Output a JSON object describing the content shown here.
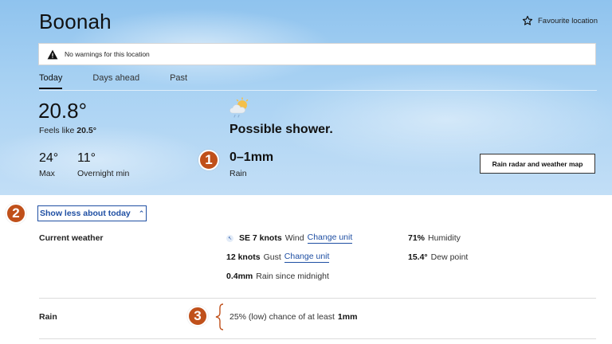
{
  "header": {
    "location": "Boonah",
    "favourite_label": "Favourite location"
  },
  "warning": {
    "text": "No warnings for this location",
    "icon": "warning-triangle-icon"
  },
  "tabs": [
    {
      "label": "Today",
      "active": true
    },
    {
      "label": "Days ahead",
      "active": false
    },
    {
      "label": "Past",
      "active": false
    }
  ],
  "today": {
    "temperature": "20.8°",
    "feels_like_label": "Feels like",
    "feels_like_value": "20.5°",
    "max_value": "24°",
    "max_label": "Max",
    "overnight_value": "11°",
    "overnight_label": "Overnight min",
    "forecast": "Possible shower.",
    "rain_value": "0–1mm",
    "rain_label": "Rain",
    "radar_button": "Rain radar and weather map",
    "weather_icon": "possible-shower-icon"
  },
  "callouts": [
    "1",
    "2",
    "3"
  ],
  "details": {
    "toggle_label": "Show less about today",
    "current_weather_label": "Current weather",
    "wind_value": "SE 7 knots",
    "wind_label": "Wind",
    "gust_value": "12 knots",
    "gust_label": "Gust",
    "change_unit": "Change unit",
    "rain_midnight_value": "0.4mm",
    "rain_midnight_label": "Rain since midnight",
    "humidity_value": "71%",
    "humidity_label": "Humidity",
    "dewpoint_value": "15.4°",
    "dewpoint_label": "Dew point",
    "rain_section_label": "Rain",
    "rain_chance_text": "25% (low) chance of at least",
    "rain_chance_amount": "1mm"
  }
}
